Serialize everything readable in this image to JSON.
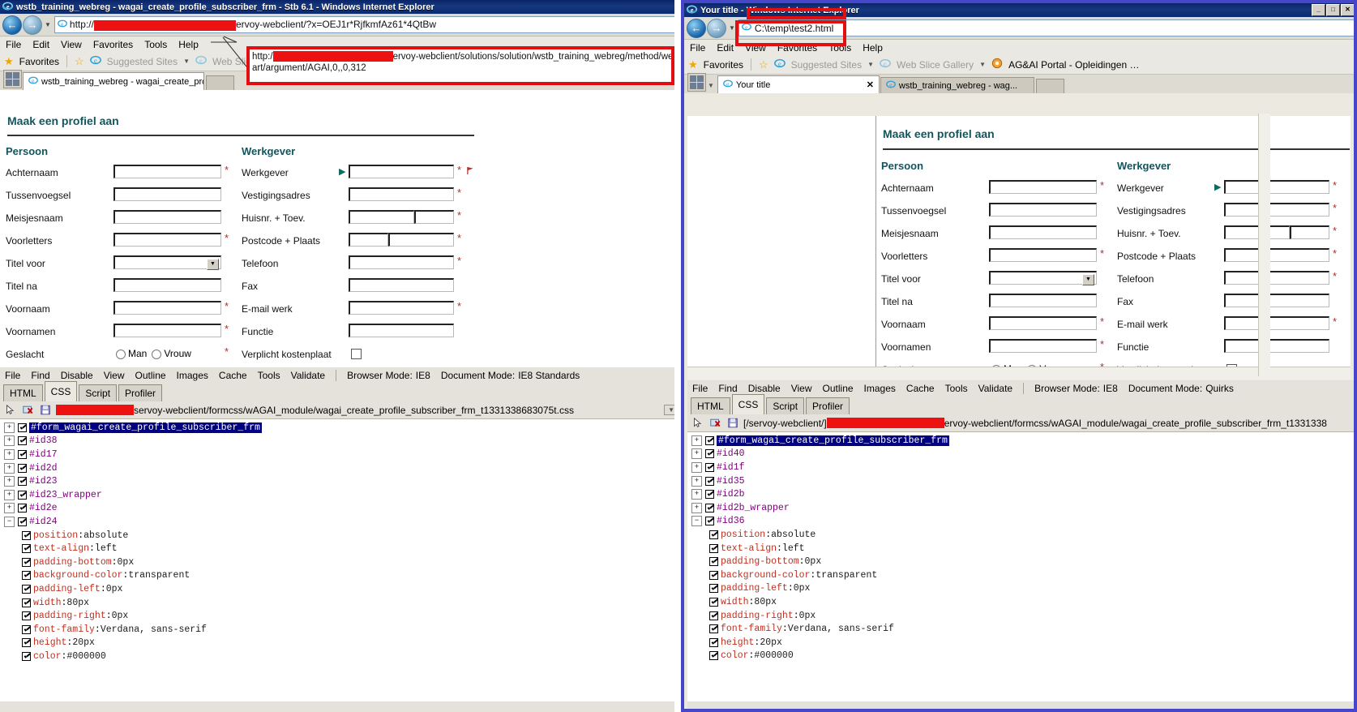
{
  "left_window": {
    "title": "wstb_training_webreg - wagai_create_profile_subscriber_frm - Stb 6.1 - Windows Internet Explorer",
    "address": "http://                              ervoy-webclient/?x=OEJ1r*RjfkmfAz61*4QtBw",
    "address_prefix": "http://",
    "address_suffix": "ervoy-webclient/?x=OEJ1r*RjfkmfAz61*4QtBw",
    "menu": [
      "File",
      "Edit",
      "View",
      "Favorites",
      "Tools",
      "Help"
    ],
    "favbar": {
      "favorites": "Favorites",
      "suggested": "Suggested Sites",
      "webslice": "Web Slice Gallery"
    },
    "tabs": [
      {
        "label": "wstb_training_webreg - wagai_create_profile_subscri...",
        "active": true
      }
    ],
    "annotation": {
      "line1_prefix": "http:/",
      "line1_suffix": "ervoy-webclient/solutions/solution/wstb_training_webreg/method/webr_app_st",
      "line2": "art/argument/AGAI,0,,0,312"
    }
  },
  "right_window": {
    "title": "Your title - Windows Internet Explorer",
    "address": "C:\\temp\\test2.html",
    "menu": [
      "File",
      "Edit",
      "View",
      "Favorites",
      "Tools",
      "Help"
    ],
    "favbar": {
      "favorites": "Favorites",
      "suggested": "Suggested Sites",
      "webslice": "Web Slice Gallery",
      "portal": "AG&AI Portal - Opleidingen …"
    },
    "tabs": [
      {
        "label": "Your title",
        "active": true,
        "closable": true
      },
      {
        "label": "wstb_training_webreg - wag...",
        "active": false,
        "closable": false
      }
    ],
    "winbtns": [
      "_",
      "□",
      "✕"
    ]
  },
  "form": {
    "page_title": "Maak een profiel aan",
    "person_heading": "Persoon",
    "employer_heading": "Werkgever",
    "person_fields": [
      {
        "label": "Achternaam",
        "required": true,
        "type": "text"
      },
      {
        "label": "Tussenvoegsel",
        "required": false,
        "type": "text"
      },
      {
        "label": "Meisjesnaam",
        "required": false,
        "type": "text"
      },
      {
        "label": "Voorletters",
        "required": true,
        "type": "text"
      },
      {
        "label": "Titel voor",
        "required": false,
        "type": "select"
      },
      {
        "label": "Titel na",
        "required": false,
        "type": "text"
      },
      {
        "label": "Voornaam",
        "required": true,
        "type": "text"
      },
      {
        "label": "Voornamen",
        "required": true,
        "type": "text"
      },
      {
        "label": "Geslacht",
        "required": true,
        "type": "radio"
      }
    ],
    "employer_fields": [
      {
        "label": "Werkgever",
        "required": true,
        "type": "text",
        "arrow": true
      },
      {
        "label": "Vestigingsadres",
        "required": true,
        "type": "text"
      },
      {
        "label": "Huisnr. + Toev.",
        "required": true,
        "type": "split",
        "split": [
          0.62,
          0.38
        ]
      },
      {
        "label": "Postcode + Plaats",
        "required": true,
        "type": "split",
        "split": [
          0.38,
          0.62
        ]
      },
      {
        "label": "Telefoon",
        "required": true,
        "type": "text"
      },
      {
        "label": "Fax",
        "required": false,
        "type": "text"
      },
      {
        "label": "E-mail werk",
        "required": true,
        "type": "text"
      },
      {
        "label": "Functie",
        "required": false,
        "type": "text"
      },
      {
        "label": "Verplicht kostenplaat",
        "required": false,
        "type": "checkbox"
      }
    ],
    "radio_options": [
      "Man",
      "Vrouw"
    ],
    "required_marker": "*"
  },
  "devtools": {
    "menu": [
      "File",
      "Find",
      "Disable",
      "View",
      "Outline",
      "Images",
      "Cache",
      "Tools",
      "Validate"
    ],
    "browser_mode_label": "Browser Mode:",
    "document_mode_label": "Document Mode:",
    "tabs": [
      "HTML",
      "CSS",
      "Script",
      "Profiler"
    ],
    "active_tab": "CSS",
    "left": {
      "browser_mode": "IE8",
      "document_mode": "IE8 Standards",
      "css_url_suffix": "servoy-webclient/formcss/wAGAI_module/wagai_create_profile_subscriber_frm_t1331338683075t.css",
      "css_url_prefix": "",
      "rules": [
        {
          "name": "#form_wagai_create_profile_subscriber_frm",
          "expanded": false,
          "selected": true
        },
        {
          "name": "#id38",
          "expanded": false,
          "selected": false
        },
        {
          "name": "#id17",
          "expanded": false,
          "selected": false
        },
        {
          "name": "#id2d",
          "expanded": false,
          "selected": false
        },
        {
          "name": "#id23",
          "expanded": false,
          "selected": false
        },
        {
          "name": "#id23_wrapper",
          "expanded": false,
          "selected": false
        },
        {
          "name": "#id2e",
          "expanded": false,
          "selected": false
        },
        {
          "name": "#id24",
          "expanded": true,
          "selected": false
        }
      ],
      "declarations": [
        {
          "prop": "position",
          "value": "absolute"
        },
        {
          "prop": "text-align",
          "value": "left"
        },
        {
          "prop": "padding-bottom",
          "value": "0px"
        },
        {
          "prop": "background-color",
          "value": "transparent"
        },
        {
          "prop": "padding-left",
          "value": "0px"
        },
        {
          "prop": "width",
          "value": "80px"
        },
        {
          "prop": "padding-right",
          "value": "0px"
        },
        {
          "prop": "font-family",
          "value": "Verdana, sans-serif"
        },
        {
          "prop": "height",
          "value": "20px"
        },
        {
          "prop": "color",
          "value": "#000000"
        }
      ]
    },
    "right": {
      "browser_mode": "IE8",
      "document_mode": "Quirks",
      "css_url_prefix": "[/servoy-webclient/]",
      "css_url_suffix": "ervoy-webclient/formcss/wAGAI_module/wagai_create_profile_subscriber_frm_t1331338",
      "rules": [
        {
          "name": "#form_wagai_create_profile_subscriber_frm",
          "expanded": false,
          "selected": true
        },
        {
          "name": "#id40",
          "expanded": false,
          "selected": false
        },
        {
          "name": "#id1f",
          "expanded": false,
          "selected": false
        },
        {
          "name": "#id35",
          "expanded": false,
          "selected": false
        },
        {
          "name": "#id2b",
          "expanded": false,
          "selected": false
        },
        {
          "name": "#id2b_wrapper",
          "expanded": false,
          "selected": false
        },
        {
          "name": "#id36",
          "expanded": true,
          "selected": false
        }
      ],
      "declarations": [
        {
          "prop": "position",
          "value": "absolute"
        },
        {
          "prop": "text-align",
          "value": "left"
        },
        {
          "prop": "padding-bottom",
          "value": "0px"
        },
        {
          "prop": "background-color",
          "value": "transparent"
        },
        {
          "prop": "padding-left",
          "value": "0px"
        },
        {
          "prop": "width",
          "value": "80px"
        },
        {
          "prop": "padding-right",
          "value": "0px"
        },
        {
          "prop": "font-family",
          "value": "Verdana, sans-serif"
        },
        {
          "prop": "height",
          "value": "20px"
        },
        {
          "prop": "color",
          "value": "#000000"
        }
      ]
    }
  },
  "colors": {
    "title_blue": "#0a246a",
    "heading_teal": "#12555c",
    "annotation_red": "#e10f0f",
    "redaction_red": "#ee1111",
    "selection_blue": "#000080",
    "window_frame_blue": "#4646c8"
  }
}
